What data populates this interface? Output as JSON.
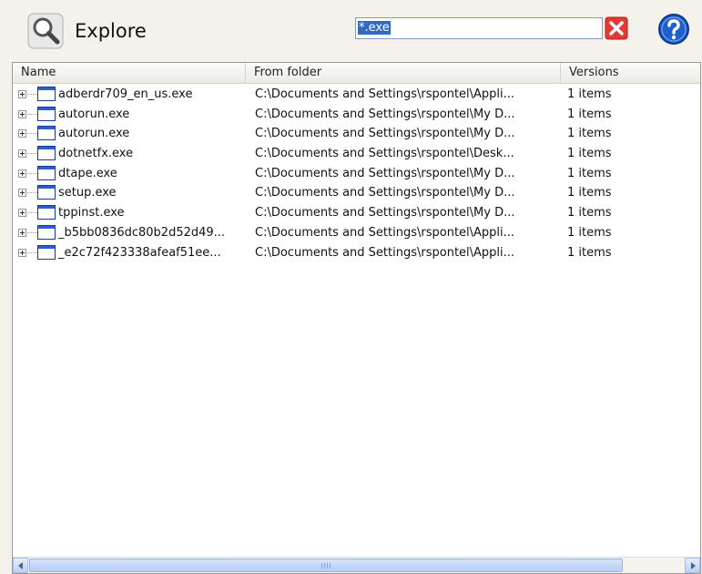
{
  "header": {
    "title": "Explore",
    "icon": "magnifier-icon"
  },
  "search": {
    "value": "*.exe",
    "clear_icon": "red-x-icon",
    "help_icon": "question-mark-icon"
  },
  "colors": {
    "selection": "#316ac5",
    "help_blue": "#1f5fc9",
    "clear_red": "#e53935"
  },
  "columns": [
    "Name",
    "From folder",
    "Versions"
  ],
  "rows": [
    {
      "name": "adberdr709_en_us.exe",
      "folder": "C:\\Documents and Settings\\rspontel\\Appli...",
      "versions": "1 items"
    },
    {
      "name": "autorun.exe",
      "folder": "C:\\Documents and Settings\\rspontel\\My D...",
      "versions": "1 items"
    },
    {
      "name": "autorun.exe",
      "folder": "C:\\Documents and Settings\\rspontel\\My D...",
      "versions": "1 items"
    },
    {
      "name": "dotnetfx.exe",
      "folder": "C:\\Documents and Settings\\rspontel\\Desk...",
      "versions": "1 items"
    },
    {
      "name": "dtape.exe",
      "folder": "C:\\Documents and Settings\\rspontel\\My D...",
      "versions": "1 items"
    },
    {
      "name": "setup.exe",
      "folder": "C:\\Documents and Settings\\rspontel\\My D...",
      "versions": "1 items"
    },
    {
      "name": "tppinst.exe",
      "folder": "C:\\Documents and Settings\\rspontel\\My D...",
      "versions": "1 items"
    },
    {
      "name": "_b5bb0836dc80b2d52d49...",
      "folder": "C:\\Documents and Settings\\rspontel\\Appli...",
      "versions": "1 items"
    },
    {
      "name": "_e2c72f423338afeaf51ee...",
      "folder": "C:\\Documents and Settings\\rspontel\\Appli...",
      "versions": "1 items"
    }
  ]
}
